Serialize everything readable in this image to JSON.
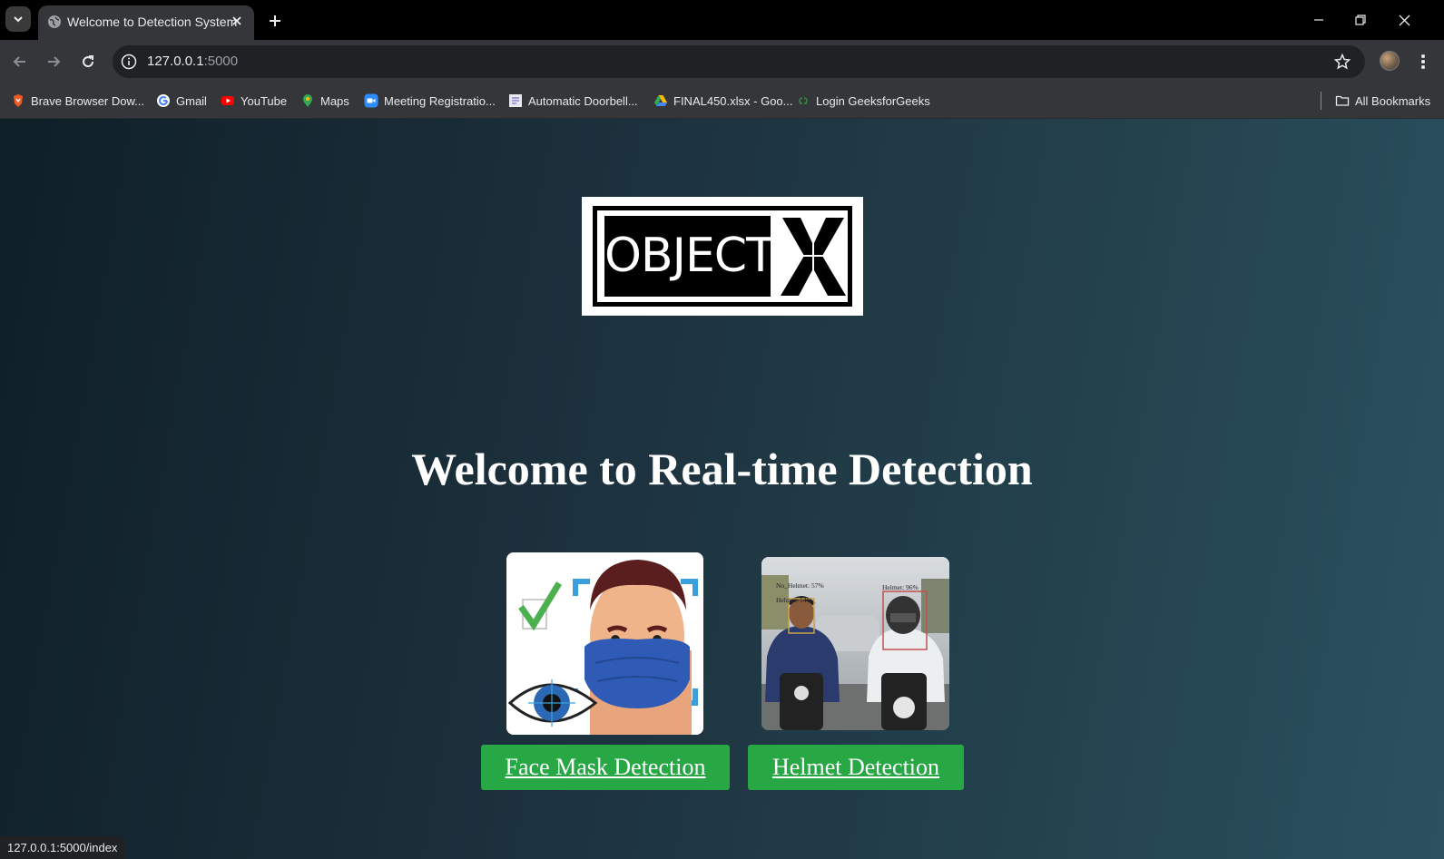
{
  "browser": {
    "tab": {
      "title": "Welcome to Detection System"
    },
    "address": {
      "host": "127.0.0.1",
      "port": ":5000"
    },
    "bookmarks": [
      {
        "label": "Brave Browser Dow...",
        "icon": "brave-icon"
      },
      {
        "label": "Gmail",
        "icon": "google-icon"
      },
      {
        "label": "YouTube",
        "icon": "youtube-icon"
      },
      {
        "label": "Maps",
        "icon": "maps-icon"
      },
      {
        "label": "Meeting Registratio...",
        "icon": "zoom-icon"
      },
      {
        "label": "Automatic Doorbell...",
        "icon": "doc-icon"
      },
      {
        "label": "FINAL450.xlsx - Goo...",
        "icon": "drive-icon"
      },
      {
        "label": "Login GeeksforGeeks",
        "icon": "gfg-icon"
      }
    ],
    "all_bookmarks_label": "All Bookmarks",
    "status_url": "127.0.0.1:5000/index"
  },
  "page": {
    "logo": {
      "word": "OBJECT",
      "mark": "X"
    },
    "headline": "Welcome to Real-time Detection",
    "cards": [
      {
        "button_label": "Face Mask Detection"
      },
      {
        "button_label": "Helmet Detection",
        "image_labels": [
          "No_Helmet: 57%",
          "Helmet: 14%",
          "Helmet: 96%"
        ]
      }
    ]
  },
  "colors": {
    "button_green": "#28a745",
    "page_bg_start": "#0f1f28",
    "page_bg_end": "#2b5160",
    "tab_bg": "#35363a"
  }
}
